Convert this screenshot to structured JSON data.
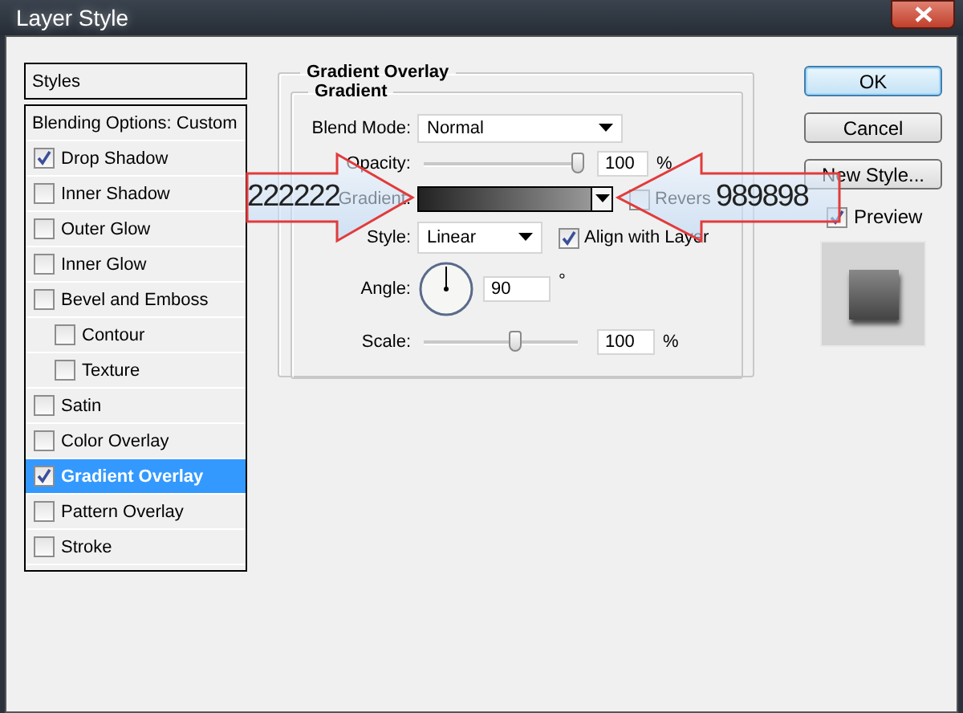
{
  "window": {
    "title": "Layer Style"
  },
  "styles_list": {
    "header": "Styles",
    "items": [
      {
        "label": "Blending Options: Custom",
        "kind": "plain",
        "selected": false
      },
      {
        "label": "Drop Shadow",
        "kind": "check",
        "checked": true,
        "selected": false
      },
      {
        "label": "Inner Shadow",
        "kind": "check",
        "checked": false,
        "selected": false
      },
      {
        "label": "Outer Glow",
        "kind": "check",
        "checked": false,
        "selected": false
      },
      {
        "label": "Inner Glow",
        "kind": "check",
        "checked": false,
        "selected": false
      },
      {
        "label": "Bevel and Emboss",
        "kind": "check",
        "checked": false,
        "selected": false
      },
      {
        "label": "Contour",
        "kind": "subcheck",
        "checked": false,
        "selected": false
      },
      {
        "label": "Texture",
        "kind": "subcheck",
        "checked": false,
        "selected": false
      },
      {
        "label": "Satin",
        "kind": "check",
        "checked": false,
        "selected": false
      },
      {
        "label": "Color Overlay",
        "kind": "check",
        "checked": false,
        "selected": false
      },
      {
        "label": "Gradient Overlay",
        "kind": "check",
        "checked": true,
        "selected": true
      },
      {
        "label": "Pattern Overlay",
        "kind": "check",
        "checked": false,
        "selected": false
      },
      {
        "label": "Stroke",
        "kind": "check",
        "checked": false,
        "selected": false
      }
    ]
  },
  "panel": {
    "title": "Gradient Overlay",
    "group": "Gradient",
    "blend_mode": {
      "label": "Blend Mode:",
      "value": "Normal"
    },
    "opacity": {
      "label": "Opacity:",
      "level": 1.0,
      "value": "100",
      "unit": "%"
    },
    "gradient": {
      "label": "Gradient:"
    },
    "reverse": {
      "label": "Revers",
      "checked": false
    },
    "style": {
      "label": "Style:",
      "value": "Linear"
    },
    "align": {
      "label": "Align with Layer",
      "checked": true
    },
    "angle": {
      "label": "Angle:",
      "value": "90",
      "unit": "°"
    },
    "scale": {
      "label": "Scale:",
      "level": 0.6,
      "value": "100",
      "unit": "%"
    }
  },
  "buttons": [
    {
      "label": "OK",
      "default": true
    },
    {
      "label": "Cancel",
      "default": false
    },
    {
      "label": "New Style...",
      "default": false
    }
  ],
  "preview": {
    "label": "Preview",
    "checked": true
  },
  "callouts": [
    {
      "text": "222222",
      "kind": "rightarrow"
    },
    {
      "text": "989898",
      "kind": "leftarrow"
    }
  ]
}
